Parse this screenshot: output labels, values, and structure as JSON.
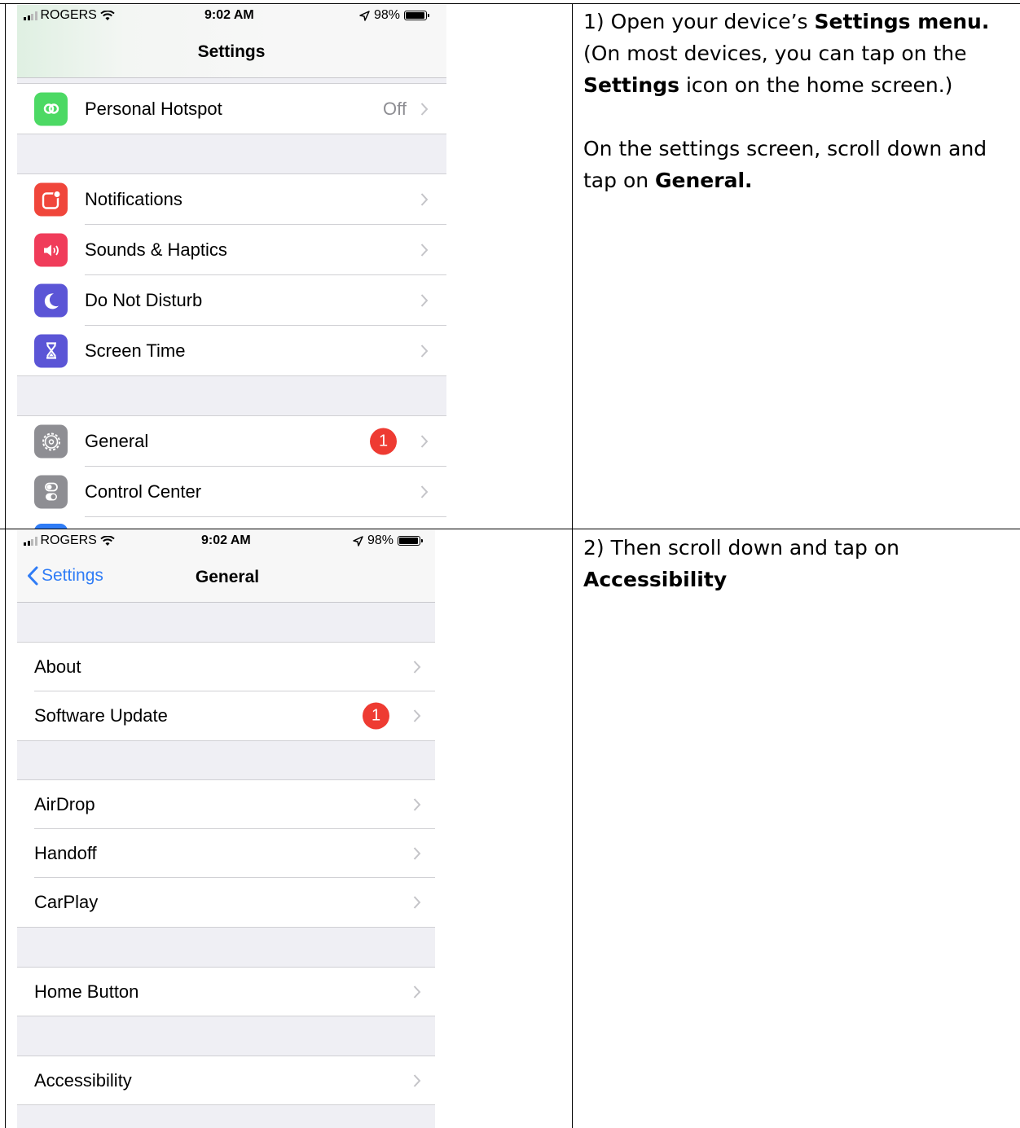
{
  "step1": {
    "status": {
      "carrier": "ROGERS",
      "time": "9:02 AM",
      "battery": "98%"
    },
    "title": "Settings",
    "rows": [
      {
        "label": "Personal Hotspot",
        "detail": "Off",
        "icon": "personal-hotspot-icon",
        "color": "#4cd964"
      },
      {
        "label": "Notifications",
        "icon": "notifications-icon",
        "color": "#f0463b"
      },
      {
        "label": "Sounds & Haptics",
        "icon": "sounds-icon",
        "color": "#f03c5a"
      },
      {
        "label": "Do Not Disturb",
        "icon": "moon-icon",
        "color": "#5b55d6"
      },
      {
        "label": "Screen Time",
        "icon": "hourglass-icon",
        "color": "#5b55d6"
      },
      {
        "label": "General",
        "badge": "1",
        "icon": "gear-icon",
        "color": "#8e8e93"
      },
      {
        "label": "Control Center",
        "icon": "switches-icon",
        "color": "#8e8e93"
      }
    ],
    "instruction": {
      "part1": "1) Open your device’s ",
      "bold1": "Settings menu.",
      "part2": "(On most devices, you can tap on the ",
      "bold2": "Settings",
      "part3": " icon on the home screen.)",
      "part4": "On the settings screen, scroll down and tap on ",
      "bold3": "General."
    }
  },
  "step2": {
    "status": {
      "carrier": "ROGERS",
      "time": "9:02 AM",
      "battery": "98%"
    },
    "back": "Settings",
    "title": "General",
    "rows": [
      {
        "label": "About"
      },
      {
        "label": "Software Update",
        "badge": "1"
      },
      {
        "label": "AirDrop"
      },
      {
        "label": "Handoff"
      },
      {
        "label": "CarPlay"
      },
      {
        "label": "Home Button"
      },
      {
        "label": "Accessibility"
      }
    ],
    "instruction": {
      "part1": "2) Then scroll down and tap on",
      "bold1": "Accessibility"
    }
  },
  "colors": {
    "accent": "#2f7cf6",
    "badge": "#ee3b32",
    "group_bg": "#efeff4"
  }
}
